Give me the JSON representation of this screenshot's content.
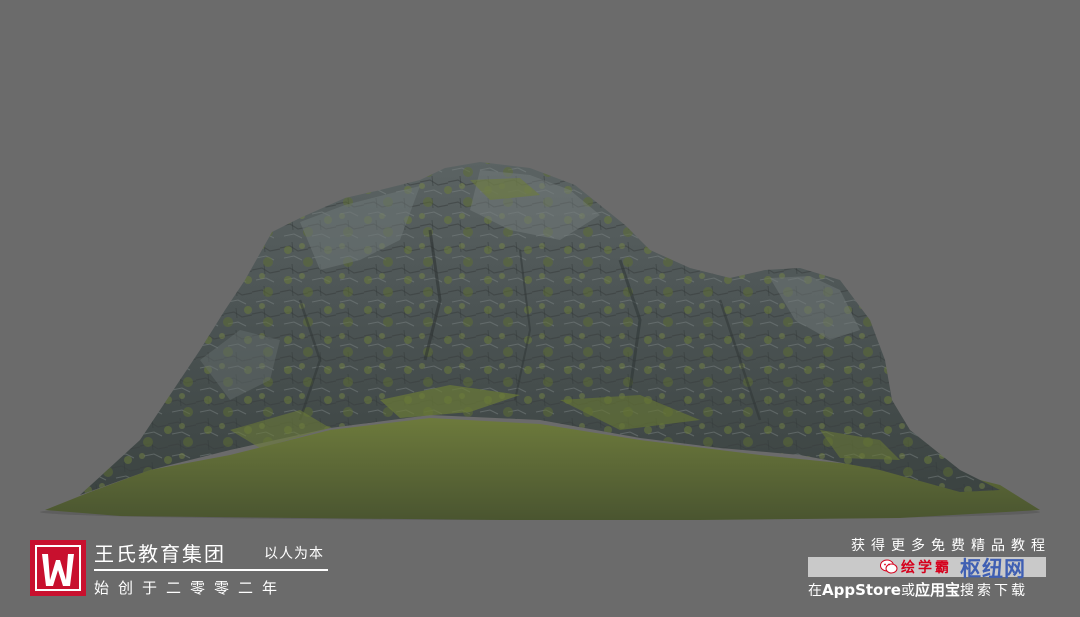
{
  "scene": {
    "background_color": "#6b6b6b",
    "subject": "rocky-mountain-render"
  },
  "branding": {
    "logo_icon": "wangshi-w-logo-icon",
    "logo_color": "#c8102e",
    "name": "王氏教育集团",
    "slogan": "以人为本",
    "founded": "始创于二零零二年"
  },
  "promo": {
    "top_text": "获得更多免费精品教程",
    "app_icon": "wechat-icon",
    "app_name": "绘学霸",
    "watermark": "枢纽网",
    "bottom_prefix": "在",
    "bottom_store1": "AppStore",
    "bottom_or": "或",
    "bottom_store2": "应用宝",
    "bottom_suffix": "搜索下载"
  }
}
